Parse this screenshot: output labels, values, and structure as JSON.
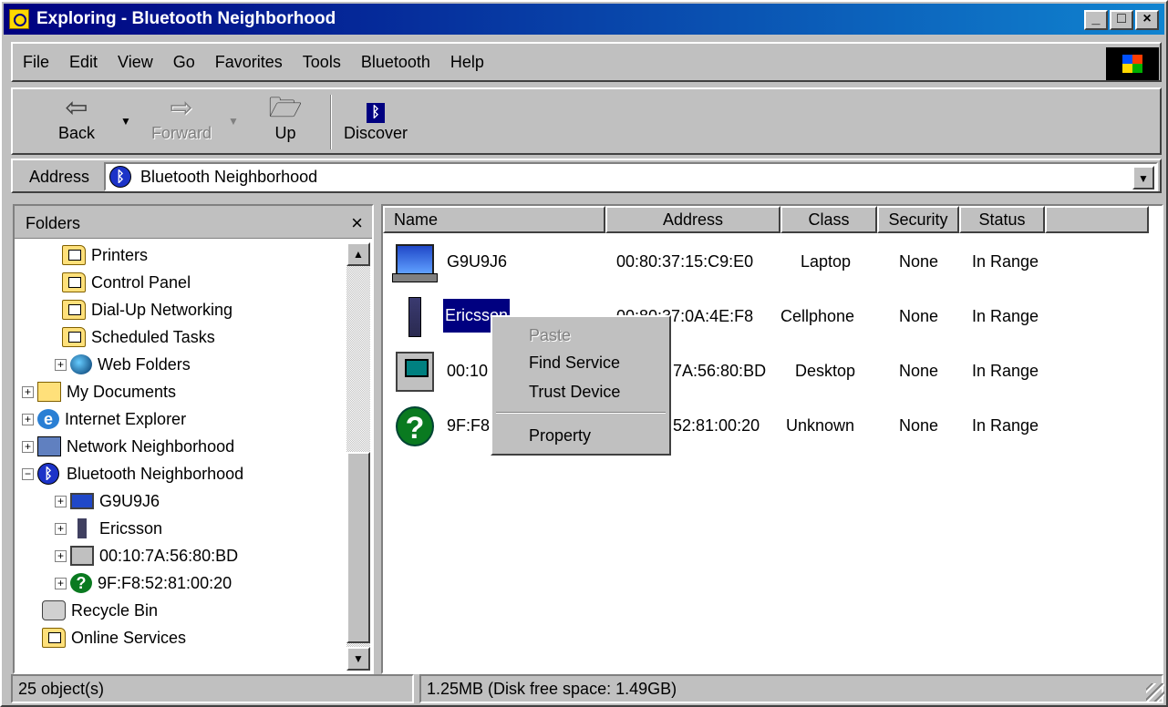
{
  "window": {
    "title": "Exploring - Bluetooth Neighborhood",
    "controls": {
      "minimize": "_",
      "maximize": "□",
      "close": "×"
    }
  },
  "menu": [
    "File",
    "Edit",
    "View",
    "Go",
    "Favorites",
    "Tools",
    "Bluetooth",
    "Help"
  ],
  "toolbar": {
    "back": "Back",
    "forward": "Forward",
    "up": "Up",
    "discover": "Discover"
  },
  "address": {
    "label": "Address",
    "value": "Bluetooth Neighborhood"
  },
  "folders": {
    "title": "Folders",
    "close": "×",
    "tree": [
      {
        "label": "Printers",
        "icon": "printers-folder-icon"
      },
      {
        "label": "Control Panel",
        "icon": "control-panel-icon"
      },
      {
        "label": "Dial-Up Networking",
        "icon": "dialup-icon"
      },
      {
        "label": "Scheduled Tasks",
        "icon": "scheduled-tasks-icon"
      },
      {
        "label": "Web Folders",
        "icon": "web-folders-icon"
      },
      {
        "label": "My Documents",
        "icon": "my-documents-icon"
      },
      {
        "label": "Internet Explorer",
        "icon": "internet-explorer-icon"
      },
      {
        "label": "Network Neighborhood",
        "icon": "network-icon"
      },
      {
        "label": "Bluetooth Neighborhood",
        "icon": "bluetooth-icon"
      },
      {
        "label": "G9U9J6",
        "icon": "laptop-icon"
      },
      {
        "label": "Ericsson",
        "icon": "cellphone-icon"
      },
      {
        "label": "00:10:7A:56:80:BD",
        "icon": "desktop-icon"
      },
      {
        "label": "9F:F8:52:81:00:20",
        "icon": "unknown-device-icon"
      },
      {
        "label": "Recycle Bin",
        "icon": "recycle-bin-icon"
      },
      {
        "label": "Online Services",
        "icon": "online-services-icon"
      }
    ]
  },
  "list": {
    "columns": [
      "Name",
      "Address",
      "Class",
      "Security",
      "Status"
    ],
    "rows": [
      {
        "name": "G9U9J6",
        "address": "00:80:37:15:C9:E0",
        "class": "Laptop",
        "security": "None",
        "status": "In Range",
        "icon": "laptop-icon"
      },
      {
        "name": "Ericsson",
        "address": "00:80:37:0A:4E:F8",
        "class": "Cellphone",
        "security": "None",
        "status": "In Range",
        "icon": "cellphone-icon"
      },
      {
        "name": "00:10",
        "address": "7A:56:80:BD",
        "class": "Desktop",
        "security": "None",
        "status": "In Range",
        "icon": "desktop-icon"
      },
      {
        "name": "9F:F8",
        "address": "52:81:00:20",
        "class": "Unknown",
        "security": "None",
        "status": "In Range",
        "icon": "unknown-device-icon"
      }
    ]
  },
  "context_menu": {
    "paste": "Paste",
    "find_service": "Find Service",
    "trust_device": "Trust Device",
    "property": "Property"
  },
  "status": {
    "objects": "25 object(s)",
    "disk": "1.25MB (Disk free space: 1.49GB)"
  },
  "colors": {
    "title_start": "#000080",
    "title_end": "#1084d0",
    "selection": "#000080",
    "face": "#c0c0c0"
  }
}
